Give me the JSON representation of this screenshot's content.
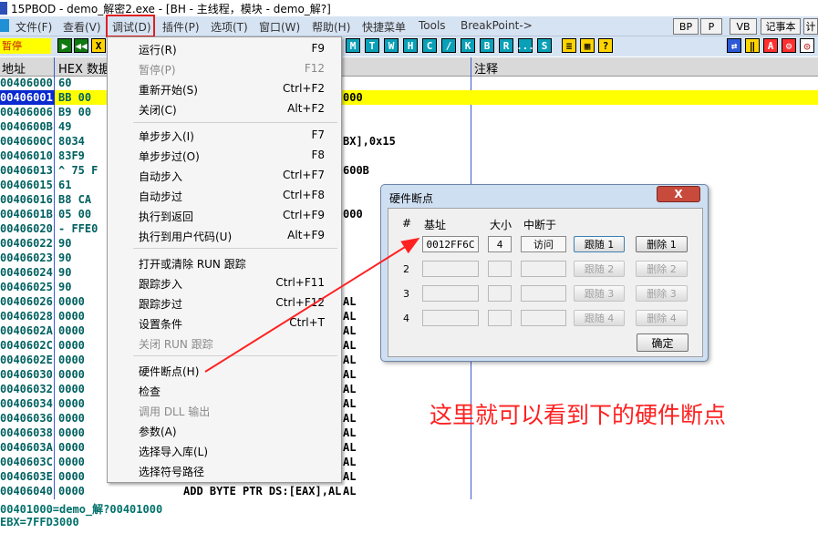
{
  "window": {
    "title": "15PBOD - demo_解密2.exe - [BH - 主线程，模块 - demo_解?]"
  },
  "menubar": {
    "file": "文件(F)",
    "view": "查看(V)",
    "debug": "调试(D)",
    "plugins": "插件(P)",
    "options": "选项(T)",
    "window": "窗口(W)",
    "help": "帮助(H)",
    "quickmenu": "快捷菜单",
    "tools": "Tools",
    "breakpoint": "BreakPoint->",
    "right_buttons": [
      "BP",
      "P",
      "VB",
      "记事本",
      "计"
    ]
  },
  "toolbar": {
    "status": "暂停",
    "letters": [
      "M",
      "T",
      "W",
      "H",
      "C",
      "/",
      "K",
      "B",
      "R",
      "...",
      "S"
    ]
  },
  "pane": {
    "col_addr": "地址",
    "col_hex": "HEX 数据",
    "col_comment": "注释",
    "rows": [
      {
        "addr": "00406000",
        "hex": "60"
      },
      {
        "addr": "00406001",
        "hex": "BB 00"
      },
      {
        "addr": "00406006",
        "hex": "B9 00"
      },
      {
        "addr": "0040600B",
        "hex": "49"
      },
      {
        "addr": "0040600C",
        "hex": "8034"
      },
      {
        "addr": "00406010",
        "hex": "83F9"
      },
      {
        "addr": "00406013",
        "hex": "^ 75 F"
      },
      {
        "addr": "00406015",
        "hex": "61"
      },
      {
        "addr": "00406016",
        "hex": "B8 CA"
      },
      {
        "addr": "0040601B",
        "hex": "05 00"
      },
      {
        "addr": "00406020",
        "hex": "- FFE0"
      },
      {
        "addr": "00406022",
        "hex": "90"
      },
      {
        "addr": "00406023",
        "hex": "90"
      },
      {
        "addr": "00406024",
        "hex": "90"
      },
      {
        "addr": "00406025",
        "hex": "90"
      },
      {
        "addr": "00406026",
        "hex": "0000"
      },
      {
        "addr": "00406028",
        "hex": "0000"
      },
      {
        "addr": "0040602A",
        "hex": "0000"
      },
      {
        "addr": "0040602C",
        "hex": "0000"
      },
      {
        "addr": "0040602E",
        "hex": "0000"
      },
      {
        "addr": "00406030",
        "hex": "0000"
      },
      {
        "addr": "00406032",
        "hex": "0000"
      },
      {
        "addr": "00406034",
        "hex": "0000"
      },
      {
        "addr": "00406036",
        "hex": "0000"
      },
      {
        "addr": "00406038",
        "hex": "0000"
      },
      {
        "addr": "0040603A",
        "hex": "0000"
      },
      {
        "addr": "0040603C",
        "hex": "0000"
      },
      {
        "addr": "0040603E",
        "hex": "0000"
      },
      {
        "addr": "00406040",
        "hex": "0000"
      }
    ],
    "asm_fragments": [
      "000",
      "BX],0x15",
      "600B",
      "000",
      "AL",
      "AL",
      "AL",
      "AL",
      "AL",
      "AL",
      "AL",
      "AL",
      "AL",
      "AL",
      "AL",
      "AL",
      "AL",
      "AL",
      "ADD BYTE PTR DS:[EAX],AL"
    ],
    "info_lines": [
      "00401000=demo_解?00401000",
      "EBX=7FFD3000"
    ]
  },
  "debug_menu": {
    "items": [
      {
        "label": "运行(R)",
        "shortcut": "F9",
        "disabled": false
      },
      {
        "label": "暂停(P)",
        "shortcut": "F12",
        "disabled": true
      },
      {
        "label": "重新开始(S)",
        "shortcut": "Ctrl+F2",
        "disabled": false
      },
      {
        "label": "关闭(C)",
        "shortcut": "Alt+F2",
        "disabled": false
      },
      {
        "label": "单步步入(I)",
        "shortcut": "F7",
        "disabled": false
      },
      {
        "label": "单步步过(O)",
        "shortcut": "F8",
        "disabled": false
      },
      {
        "label": "自动步入",
        "shortcut": "Ctrl+F7",
        "disabled": false
      },
      {
        "label": "自动步过",
        "shortcut": "Ctrl+F8",
        "disabled": false
      },
      {
        "label": "执行到返回",
        "shortcut": "Ctrl+F9",
        "disabled": false
      },
      {
        "label": "执行到用户代码(U)",
        "shortcut": "Alt+F9",
        "disabled": false
      },
      {
        "label": "打开或清除 RUN 跟踪",
        "shortcut": "",
        "disabled": false
      },
      {
        "label": "跟踪步入",
        "shortcut": "Ctrl+F11",
        "disabled": false
      },
      {
        "label": "跟踪步过",
        "shortcut": "Ctrl+F12",
        "disabled": false
      },
      {
        "label": "设置条件",
        "shortcut": "Ctrl+T",
        "disabled": false
      },
      {
        "label": "关闭 RUN 跟踪",
        "shortcut": "",
        "disabled": true
      },
      {
        "label": "硬件断点(H)",
        "shortcut": "",
        "disabled": false
      },
      {
        "label": "检查",
        "shortcut": "",
        "disabled": false
      },
      {
        "label": "调用 DLL 输出",
        "shortcut": "",
        "disabled": true
      },
      {
        "label": "参数(A)",
        "shortcut": "",
        "disabled": false
      },
      {
        "label": "选择导入库(L)",
        "shortcut": "",
        "disabled": false
      },
      {
        "label": "选择符号路径",
        "shortcut": "",
        "disabled": false
      }
    ]
  },
  "hw_dialog": {
    "title": "硬件断点",
    "close": "X",
    "headers": {
      "num": "#",
      "base": "基址",
      "size": "大小",
      "break": "中断于"
    },
    "rows": [
      {
        "num": "1",
        "base": "0012FF6C",
        "size": "4",
        "break_on": "访问",
        "follow": "跟随 1",
        "delete": "删除 1",
        "enabled": true
      },
      {
        "num": "2",
        "base": "",
        "size": "",
        "break_on": "",
        "follow": "跟随 2",
        "delete": "删除 2",
        "enabled": false
      },
      {
        "num": "3",
        "base": "",
        "size": "",
        "break_on": "",
        "follow": "跟随 3",
        "delete": "删除 3",
        "enabled": false
      },
      {
        "num": "4",
        "base": "",
        "size": "",
        "break_on": "",
        "follow": "跟随 4",
        "delete": "删除 4",
        "enabled": false
      }
    ],
    "ok": "确定"
  },
  "annotation": {
    "text": "这里就可以看到下的硬件断点",
    "color": "#ff2020"
  }
}
